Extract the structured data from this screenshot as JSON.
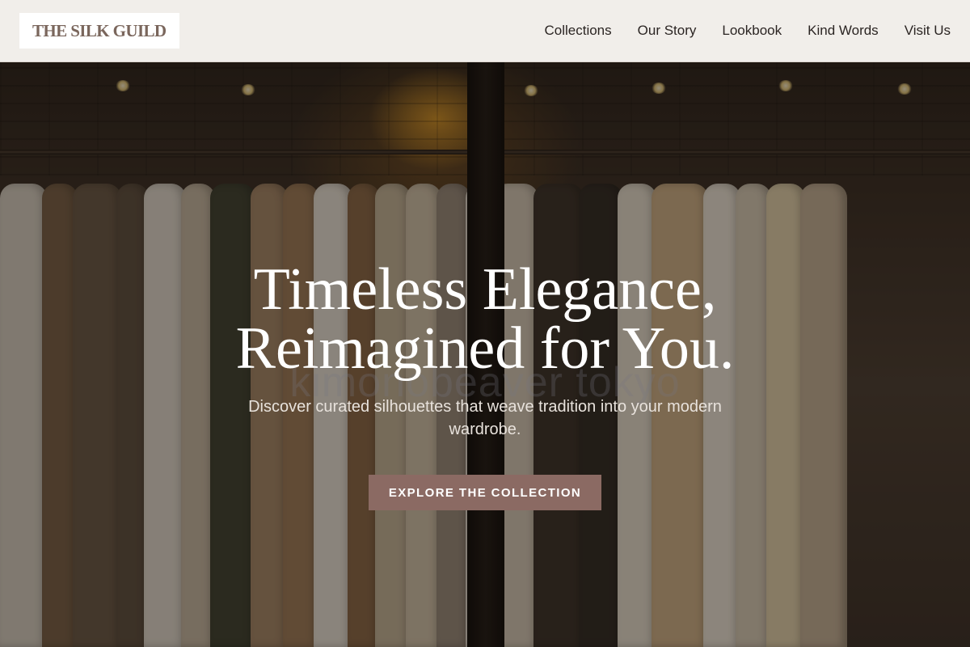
{
  "brand": {
    "name": "THE SILK GUILD"
  },
  "nav": {
    "items": [
      {
        "label": "Collections"
      },
      {
        "label": "Our Story"
      },
      {
        "label": "Lookbook"
      },
      {
        "label": "Kind Words"
      },
      {
        "label": "Visit Us"
      }
    ]
  },
  "hero": {
    "headline_line1": "Timeless Elegance,",
    "headline_line2": "Reimagined for You.",
    "watermark": "kimonobeaver tokyo",
    "subheading": "Discover curated silhouettes that weave tradition into your modern wardrobe.",
    "cta_label": "EXPLORE THE COLLECTION"
  },
  "colors": {
    "header_bg": "#f1eeea",
    "logo_text": "#7a665c",
    "cta_bg": "#8b6a63",
    "headline": "#ffffff"
  }
}
